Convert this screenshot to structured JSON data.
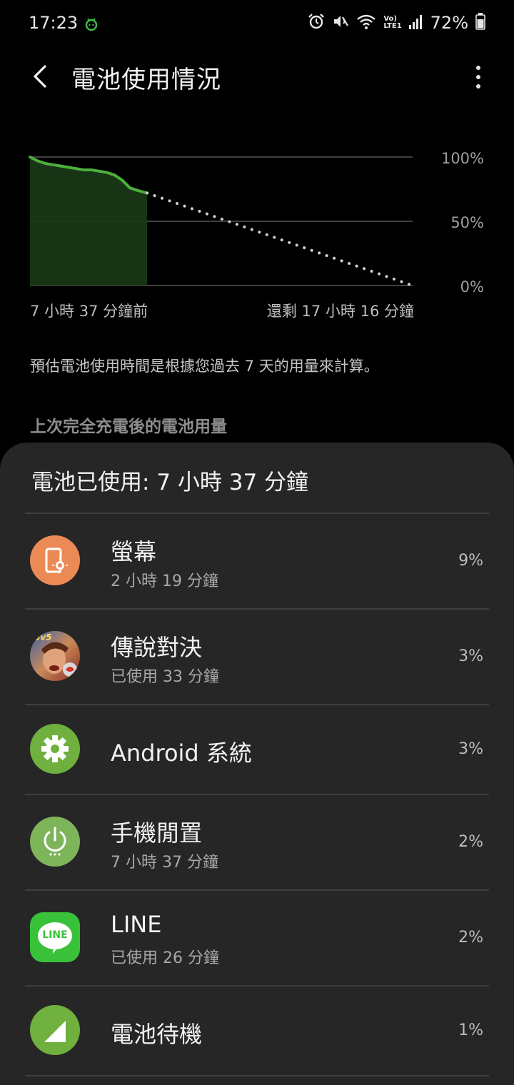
{
  "status_bar": {
    "time": "17:23",
    "battery_percent": "72%",
    "icons": [
      "android-notification-icon",
      "alarm-icon",
      "mute-icon",
      "wifi-icon",
      "volte-icon",
      "signal-icon",
      "battery-icon"
    ],
    "volte_label_top": "Vo)",
    "volte_label_bottom": "LTE1"
  },
  "header": {
    "title": "電池使用情況"
  },
  "chart_data": {
    "type": "line",
    "y_tick_labels": [
      "100%",
      "50%",
      "0%"
    ],
    "ylim": [
      0,
      100
    ],
    "x_start_label": "7 小時 37 分鐘前",
    "x_end_label": "還剩 17 小時 16 分鐘",
    "series": [
      {
        "x": [
          0,
          0.5,
          1.0,
          1.5,
          2.0,
          2.5,
          3.0,
          3.5,
          4.0,
          4.5,
          5.0,
          5.5,
          6.0,
          6.5,
          7.0,
          7.62
        ],
        "y": [
          100,
          97,
          95,
          94,
          93,
          92,
          91,
          90,
          90,
          89,
          88,
          86,
          82,
          76,
          74,
          72
        ]
      },
      {
        "x": [
          7.62,
          24.9
        ],
        "y": [
          72,
          0
        ]
      }
    ],
    "x_max_hours": 24.9,
    "grid": true,
    "colors": {
      "history": "#4caf3c",
      "history_fill": "#1a3a16",
      "projection": "#d0d0d0",
      "grid": "#555555"
    }
  },
  "estimate_note": "預估電池使用時間是根據您過去 7 天的用量來計算。",
  "section_heading": "上次完全充電後的電池用量",
  "usage": {
    "summary": "電池已使用: 7 小時 37 分鐘",
    "items": [
      {
        "name": "螢幕",
        "sub": "2 小時 19 分鐘",
        "percent": "9%",
        "icon": "screen-brightness-icon",
        "icon_color": "#ec8a55"
      },
      {
        "name": "傳說對決",
        "sub": "已使用 33 分鐘",
        "percent": "3%",
        "icon": "game-app-icon",
        "icon_color": "#b34a3a",
        "icon_text": "5v5"
      },
      {
        "name": "Android 系統",
        "sub": "",
        "percent": "3%",
        "icon": "gear-icon",
        "icon_color": "#6fb03e"
      },
      {
        "name": "手機閒置",
        "sub": "7 小時 37 分鐘",
        "percent": "2%",
        "icon": "power-idle-icon",
        "icon_color": "#7fb55a"
      },
      {
        "name": "LINE",
        "sub": "已使用 26 分鐘",
        "percent": "2%",
        "icon": "line-app-icon",
        "icon_color": "#3ac13a",
        "icon_text": "LINE"
      },
      {
        "name": "電池待機",
        "sub": "",
        "percent": "1%",
        "icon": "signal-standby-icon",
        "icon_color": "#6fb03e"
      }
    ]
  }
}
